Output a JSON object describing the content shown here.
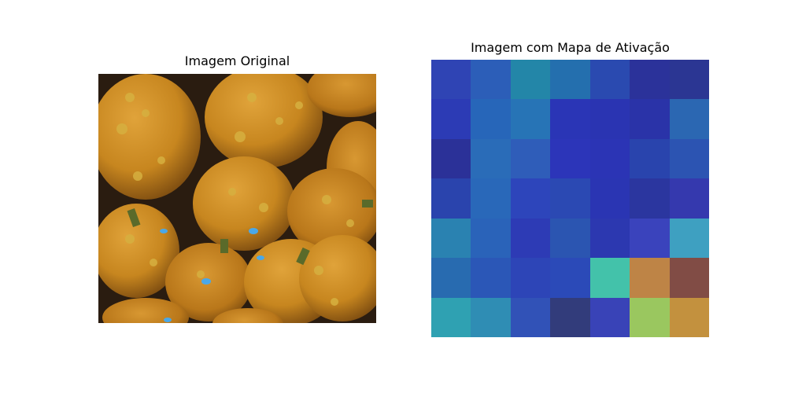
{
  "left_panel": {
    "title": "Imagem Original",
    "image_subject": "pumpkins"
  },
  "right_panel": {
    "title": "Imagem com Mapa de Ativação",
    "activation_grid": {
      "rows": 7,
      "cols": 7,
      "colors": [
        [
          "#2f44b4",
          "#2c5eb8",
          "#2386a8",
          "#246fae",
          "#2a4ab0",
          "#2b329a",
          "#2b3693"
        ],
        [
          "#2c3bb5",
          "#2766b9",
          "#2774b6",
          "#2a35b6",
          "#2a34b2",
          "#2a33a8",
          "#2b67b2"
        ],
        [
          "#2b3198",
          "#2a6cb8",
          "#2f5db9",
          "#2c35b9",
          "#2b34b5",
          "#2944ad",
          "#2c54b2"
        ],
        [
          "#2a44ad",
          "#2968b9",
          "#2d45bb",
          "#2b49b3",
          "#2a35b3",
          "#2b369f",
          "#3539ae"
        ],
        [
          "#2a82b1",
          "#2a63b9",
          "#2d3bb5",
          "#2b55b1",
          "#2c38b0",
          "#3a43bc",
          "#3ea0c1"
        ],
        [
          "#286bb0",
          "#2b57b7",
          "#2d45b7",
          "#2b4ab8",
          "#43c2aa",
          "#be8446",
          "#814c45"
        ],
        [
          "#2fa1b2",
          "#2f8db4",
          "#3152b7",
          "#323c7b",
          "#3943b7",
          "#9ac75f",
          "#c3913e"
        ]
      ]
    }
  }
}
